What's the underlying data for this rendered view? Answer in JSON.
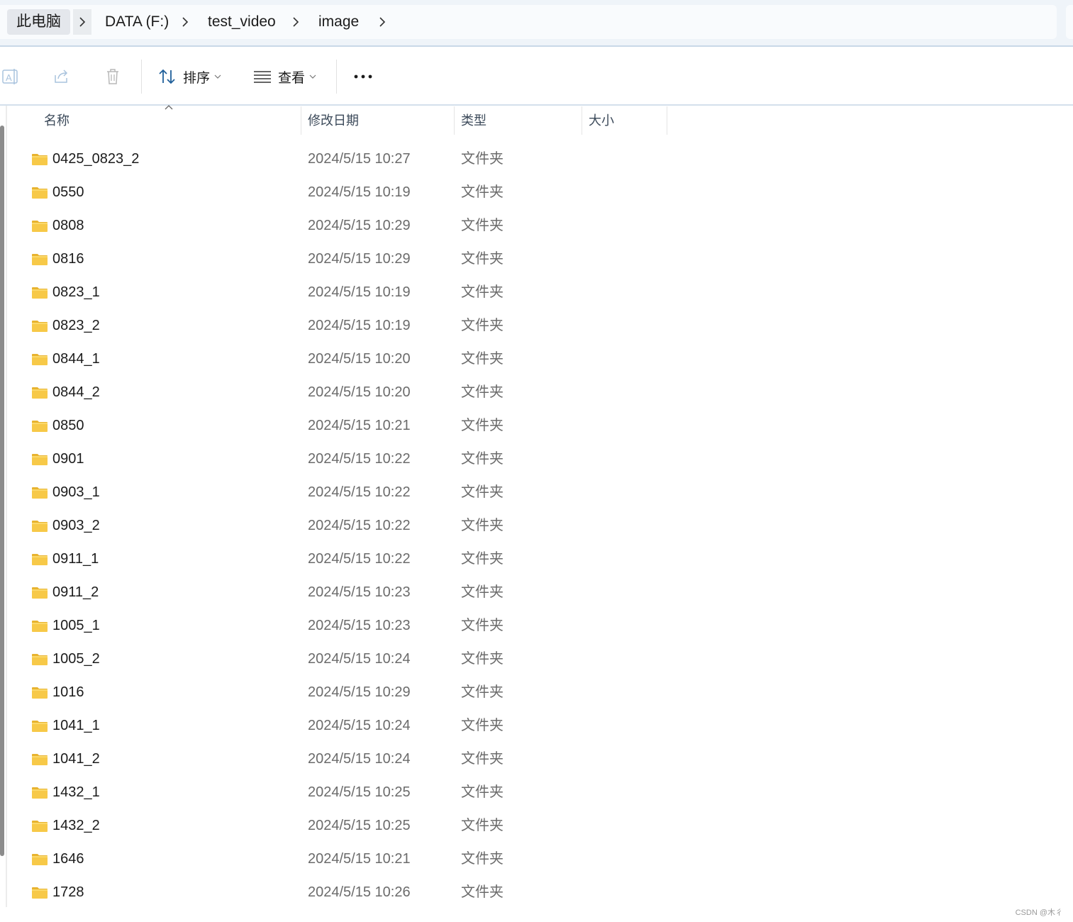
{
  "breadcrumb": {
    "items": [
      "此电脑",
      "DATA (F:)",
      "test_video",
      "image"
    ]
  },
  "toolbar": {
    "sort_label": "排序",
    "view_label": "查看"
  },
  "columns": {
    "name": "名称",
    "date": "修改日期",
    "type": "类型",
    "size": "大小"
  },
  "files": [
    {
      "name": "0425_0823_2",
      "date": "2024/5/15 10:27",
      "type": "文件夹"
    },
    {
      "name": "0550",
      "date": "2024/5/15 10:19",
      "type": "文件夹"
    },
    {
      "name": "0808",
      "date": "2024/5/15 10:29",
      "type": "文件夹"
    },
    {
      "name": "0816",
      "date": "2024/5/15 10:29",
      "type": "文件夹"
    },
    {
      "name": "0823_1",
      "date": "2024/5/15 10:19",
      "type": "文件夹"
    },
    {
      "name": "0823_2",
      "date": "2024/5/15 10:19",
      "type": "文件夹"
    },
    {
      "name": "0844_1",
      "date": "2024/5/15 10:20",
      "type": "文件夹"
    },
    {
      "name": "0844_2",
      "date": "2024/5/15 10:20",
      "type": "文件夹"
    },
    {
      "name": "0850",
      "date": "2024/5/15 10:21",
      "type": "文件夹"
    },
    {
      "name": "0901",
      "date": "2024/5/15 10:22",
      "type": "文件夹"
    },
    {
      "name": "0903_1",
      "date": "2024/5/15 10:22",
      "type": "文件夹"
    },
    {
      "name": "0903_2",
      "date": "2024/5/15 10:22",
      "type": "文件夹"
    },
    {
      "name": "0911_1",
      "date": "2024/5/15 10:22",
      "type": "文件夹"
    },
    {
      "name": "0911_2",
      "date": "2024/5/15 10:23",
      "type": "文件夹"
    },
    {
      "name": "1005_1",
      "date": "2024/5/15 10:23",
      "type": "文件夹"
    },
    {
      "name": "1005_2",
      "date": "2024/5/15 10:24",
      "type": "文件夹"
    },
    {
      "name": "1016",
      "date": "2024/5/15 10:29",
      "type": "文件夹"
    },
    {
      "name": "1041_1",
      "date": "2024/5/15 10:24",
      "type": "文件夹"
    },
    {
      "name": "1041_2",
      "date": "2024/5/15 10:24",
      "type": "文件夹"
    },
    {
      "name": "1432_1",
      "date": "2024/5/15 10:25",
      "type": "文件夹"
    },
    {
      "name": "1432_2",
      "date": "2024/5/15 10:25",
      "type": "文件夹"
    },
    {
      "name": "1646",
      "date": "2024/5/15 10:21",
      "type": "文件夹"
    },
    {
      "name": "1728",
      "date": "2024/5/15 10:26",
      "type": "文件夹"
    }
  ],
  "watermark": "CSDN @木彳",
  "colors": {
    "folder": "#f7c948",
    "accent": "#0067c0"
  },
  "icons": [
    "rename-icon",
    "share-icon",
    "delete-icon",
    "sort-icon",
    "view-list-icon",
    "more-icon",
    "chevron-right-icon",
    "folder-icon"
  ]
}
